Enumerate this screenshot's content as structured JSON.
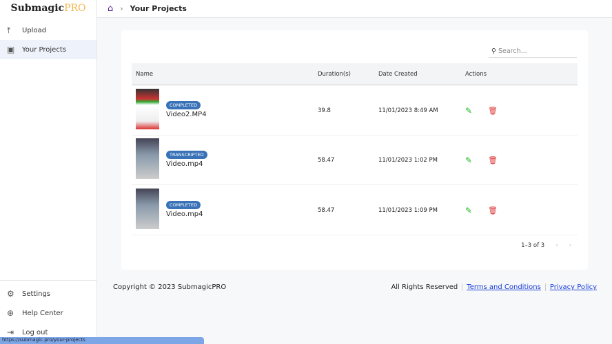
{
  "brand": {
    "name": "Submagic",
    "suffix": "PRO"
  },
  "sidebar": {
    "items": [
      {
        "label": "Upload"
      },
      {
        "label": "Your Projects"
      }
    ],
    "bottom": [
      {
        "label": "Settings"
      },
      {
        "label": "Help Center"
      },
      {
        "label": "Log out"
      }
    ]
  },
  "breadcrumb": {
    "current": "Your Projects"
  },
  "search": {
    "placeholder": "Search..."
  },
  "table": {
    "headers": [
      "Name",
      "Duration(s)",
      "Date Created",
      "Actions"
    ],
    "rows": [
      {
        "status": "COMPLETED",
        "name": "Video2.MP4",
        "duration": "39.8",
        "date": "11/01/2023 8:49 AM"
      },
      {
        "status": "TRANSCRIPTED",
        "name": "Video.mp4",
        "duration": "58.47",
        "date": "11/01/2023 1:02 PM"
      },
      {
        "status": "COMPLETED",
        "name": "Video.mp4",
        "duration": "58.47",
        "date": "11/01/2023 1:09 PM"
      }
    ]
  },
  "pagination": {
    "range": "1–3 of 3"
  },
  "footer": {
    "copyright": "Copyright © 2023 SubmagicPRO",
    "rights": "All Rights Reserved",
    "terms": "Terms and Conditions",
    "privacy": "Privacy Policy"
  },
  "statusbar": {
    "url": "https://submagic.pro/your-projects"
  }
}
